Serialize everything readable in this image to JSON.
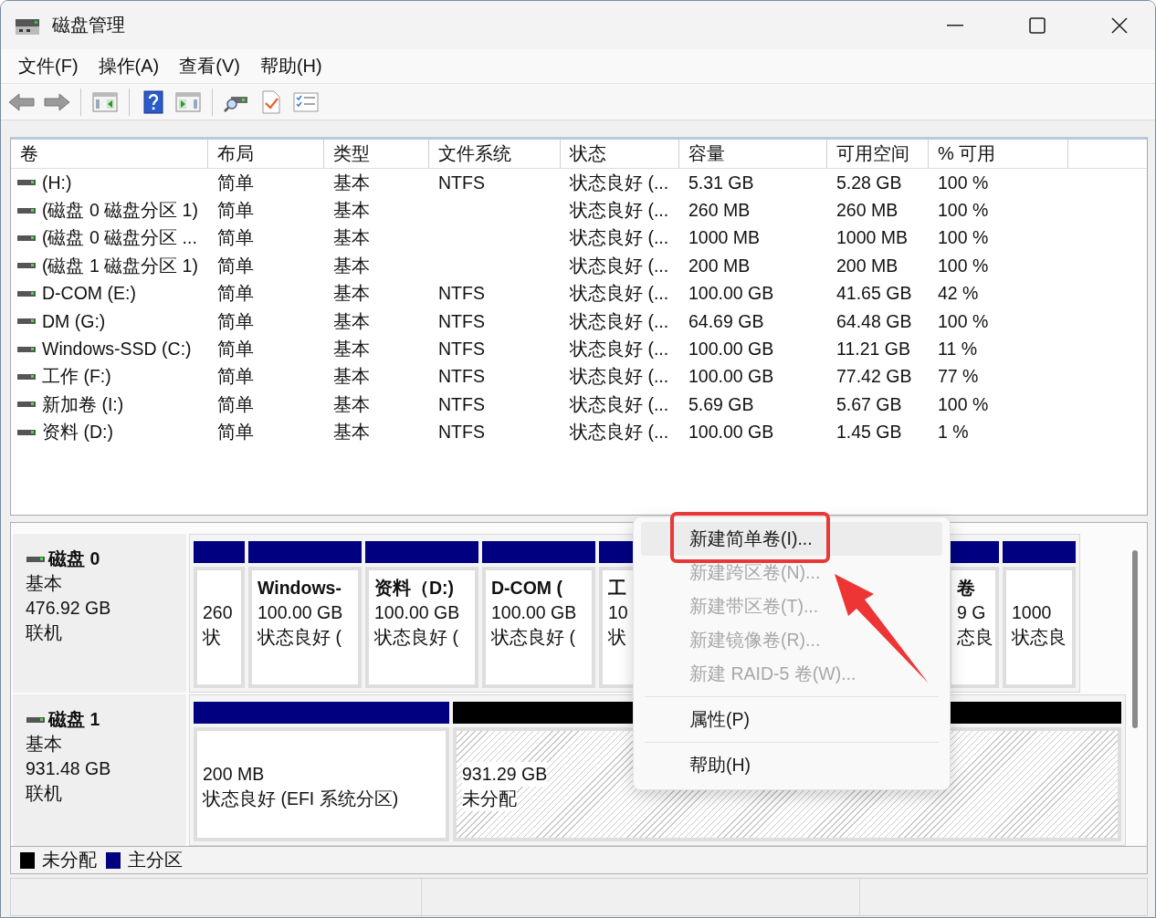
{
  "window": {
    "title": "磁盘管理"
  },
  "menu_bar": [
    "文件(F)",
    "操作(A)",
    "查看(V)",
    "帮助(H)"
  ],
  "volume_list": {
    "columns": [
      "卷",
      "布局",
      "类型",
      "文件系统",
      "状态",
      "容量",
      "可用空间",
      "% 可用"
    ],
    "rows": [
      {
        "cells": [
          "(H:)",
          "简单",
          "基本",
          "NTFS",
          "状态良好 (...",
          "5.31 GB",
          "5.28 GB",
          "100 %"
        ]
      },
      {
        "cells": [
          "(磁盘 0 磁盘分区 1)",
          "简单",
          "基本",
          null,
          "状态良好 (...",
          "260 MB",
          "260 MB",
          "100 %"
        ]
      },
      {
        "cells": [
          "(磁盘 0 磁盘分区 ...",
          "简单",
          "基本",
          null,
          "状态良好 (...",
          "1000 MB",
          "1000 MB",
          "100 %"
        ]
      },
      {
        "cells": [
          "(磁盘 1 磁盘分区 1)",
          "简单",
          "基本",
          null,
          "状态良好 (...",
          "200 MB",
          "200 MB",
          "100 %"
        ]
      },
      {
        "cells": [
          "D-COM (E:)",
          "简单",
          "基本",
          "NTFS",
          "状态良好 (...",
          "100.00 GB",
          "41.65 GB",
          "42 %"
        ]
      },
      {
        "cells": [
          "DM (G:)",
          "简单",
          "基本",
          "NTFS",
          "状态良好 (...",
          "64.69 GB",
          "64.48 GB",
          "100 %"
        ]
      },
      {
        "cells": [
          "Windows-SSD (C:)",
          "简单",
          "基本",
          "NTFS",
          "状态良好 (...",
          "100.00 GB",
          "11.21 GB",
          "11 %"
        ]
      },
      {
        "cells": [
          "工作 (F:)",
          "简单",
          "基本",
          "NTFS",
          "状态良好 (...",
          "100.00 GB",
          "77.42 GB",
          "77 %"
        ]
      },
      {
        "cells": [
          "新加卷 (I:)",
          "简单",
          "基本",
          "NTFS",
          "状态良好 (...",
          "5.69 GB",
          "5.67 GB",
          "100 %"
        ]
      },
      {
        "cells": [
          "资料 (D:)",
          "简单",
          "基本",
          "NTFS",
          "状态良好 (...",
          "100.00 GB",
          "1.45 GB",
          "1 %"
        ]
      }
    ]
  },
  "disks": [
    {
      "name": "磁盘 0",
      "info": [
        "基本",
        "476.92 GB",
        "联机"
      ],
      "partitions": [
        {
          "kind": "primary",
          "lines": [
            "260",
            "状"
          ]
        },
        {
          "kind": "primary",
          "title": "Windows-",
          "lines": [
            "100.00 GB",
            "状态良好 ("
          ]
        },
        {
          "kind": "primary",
          "title": "资料（D:)",
          "lines": [
            "100.00 GB",
            "状态良好 ("
          ]
        },
        {
          "kind": "primary",
          "title": "D-COM (",
          "lines": [
            "100.00 GB",
            "状态良好 ("
          ]
        },
        {
          "kind": "primary",
          "title": "工",
          "lines": [
            "10",
            "状"
          ]
        },
        {
          "kind": "primary",
          "title": "卷",
          "lines": [
            "9 G",
            "态良"
          ]
        },
        {
          "kind": "primary",
          "lines": [
            "1000",
            "状态良"
          ]
        }
      ]
    },
    {
      "name": "磁盘 1",
      "info": [
        "基本",
        "931.48 GB",
        "联机"
      ],
      "partitions": [
        {
          "kind": "primary",
          "lines": [
            "200 MB",
            "状态良好 (EFI 系统分区)"
          ]
        },
        {
          "kind": "unallocated",
          "lines": [
            "931.29 GB",
            "未分配"
          ]
        }
      ]
    }
  ],
  "legend": [
    {
      "label": "未分配",
      "color": "#000000"
    },
    {
      "label": "主分区",
      "color": "#000080"
    }
  ],
  "context_menu": {
    "items": [
      {
        "kind": "item",
        "label": "新建简单卷(I)...",
        "selected": true,
        "disabled": false
      },
      {
        "kind": "item",
        "label": "新建跨区卷(N)...",
        "selected": false,
        "disabled": true
      },
      {
        "kind": "item",
        "label": "新建带区卷(T)...",
        "selected": false,
        "disabled": true
      },
      {
        "kind": "item",
        "label": "新建镜像卷(R)...",
        "selected": false,
        "disabled": true
      },
      {
        "kind": "item",
        "label": "新建 RAID-5 卷(W)...",
        "selected": false,
        "disabled": true
      },
      {
        "kind": "separator"
      },
      {
        "kind": "item",
        "label": "属性(P)",
        "selected": false,
        "disabled": false
      },
      {
        "kind": "separator"
      },
      {
        "kind": "item",
        "label": "帮助(H)",
        "selected": false,
        "disabled": false
      }
    ]
  }
}
